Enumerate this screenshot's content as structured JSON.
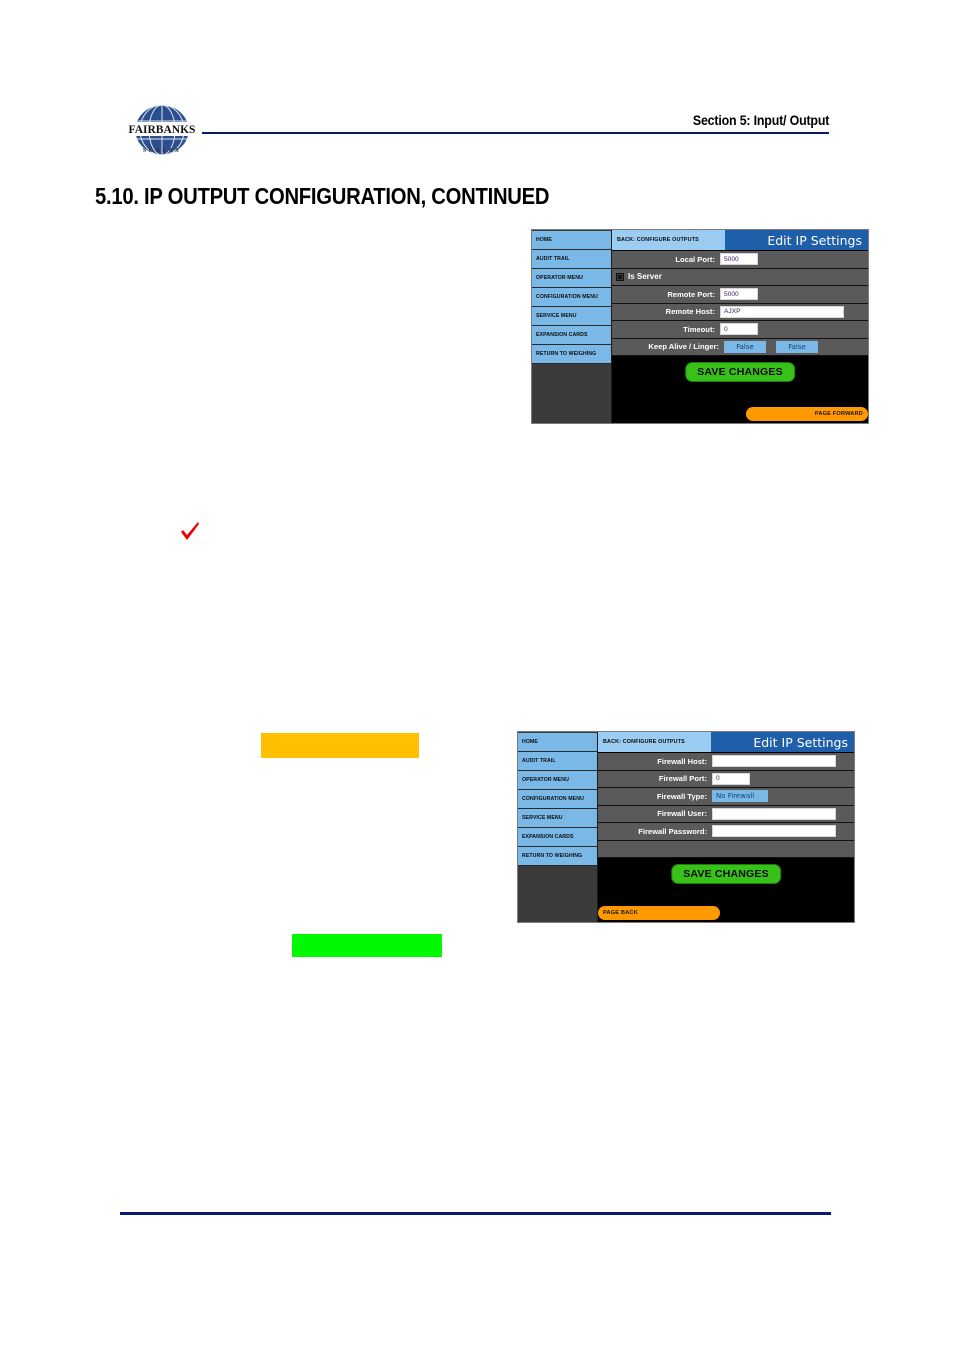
{
  "document": {
    "header_section": "Section 5: Input/ Output",
    "title": "5.10.  IP OUTPUT CONFIGURATION, CONTINUED",
    "logo_name": "FAIRBANKS",
    "logo_subtitle": "S C A L E S"
  },
  "annotations": {
    "check_mark": "red-check-mark",
    "orange_highlight": "",
    "green_highlight": ""
  },
  "screenshot_ip": {
    "titlebar": {
      "back_label": "BACK: CONFIGURE OUTPUTS",
      "title": "Edit IP Settings"
    },
    "sidebar": [
      {
        "label": "HOME"
      },
      {
        "label": "AUDIT TRAIL"
      },
      {
        "label": "OPERATOR MENU"
      },
      {
        "label": "CONFIGURATION MENU"
      },
      {
        "label": "SERVICE MENU"
      },
      {
        "label": "EXPANSION CARDS"
      },
      {
        "label": "RETURN TO WEIGHING"
      }
    ],
    "fields": {
      "local_port_label": "Local Port:",
      "local_port_value": "5000",
      "is_server_label": "Is Server",
      "is_server_checked": "checked",
      "remote_port_label": "Remote Port:",
      "remote_port_value": "5000",
      "remote_host_label": "Remote Host:",
      "remote_host_value": "AJXP",
      "timeout_label": "Timeout:",
      "timeout_value": "0",
      "keep_alive_label": "Keep Alive / Linger:",
      "keep_alive_value": "False",
      "linger_value": "False"
    },
    "buttons": {
      "save": "SAVE CHANGES",
      "page_forward": "PAGE FORWARD"
    }
  },
  "screenshot_firewall": {
    "titlebar": {
      "back_label": "BACK: CONFIGURE OUTPUTS",
      "title": "Edit IP Settings"
    },
    "sidebar": [
      {
        "label": "HOME"
      },
      {
        "label": "AUDIT TRAIL"
      },
      {
        "label": "OPERATOR MENU"
      },
      {
        "label": "CONFIGURATION MENU"
      },
      {
        "label": "SERVICE MENU"
      },
      {
        "label": "EXPANSION CARDS"
      },
      {
        "label": "RETURN TO WEIGHING"
      }
    ],
    "fields": {
      "firewall_host_label": "Firewall Host:",
      "firewall_host_value": "",
      "firewall_port_label": "Firewall Port:",
      "firewall_port_value": "0",
      "firewall_type_label": "Firewall Type:",
      "firewall_type_value": "No Firewall",
      "firewall_user_label": "Firewall User:",
      "firewall_user_value": "",
      "firewall_password_label": "Firewall Password:",
      "firewall_password_value": ""
    },
    "buttons": {
      "save": "SAVE CHANGES",
      "page_back": "PAGE BACK"
    }
  },
  "colors": {
    "brand_navy": "#0a1a6b",
    "ui_blue": "#7ab8e8",
    "ui_title_blue": "#1f5fa9",
    "ui_gray_row": "#5a5a5a",
    "save_green": "#37c119",
    "page_orange": "#ff9900",
    "highlight_orange": "#ffc000",
    "highlight_green": "#00f900",
    "check_red": "#ee0000"
  }
}
